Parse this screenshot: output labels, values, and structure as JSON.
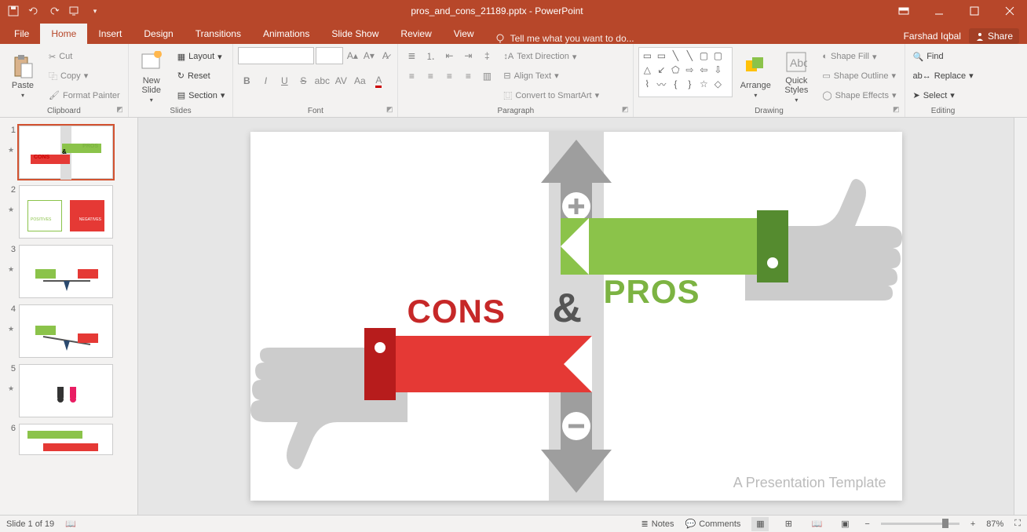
{
  "title": "pros_and_cons_21189.pptx - PowerPoint",
  "user": "Farshad Iqbal",
  "share": "Share",
  "tabs": {
    "file": "File",
    "home": "Home",
    "insert": "Insert",
    "design": "Design",
    "transitions": "Transitions",
    "animations": "Animations",
    "slideshow": "Slide Show",
    "review": "Review",
    "view": "View",
    "tellme": "Tell me what you want to do..."
  },
  "clipboard": {
    "label": "Clipboard",
    "paste": "Paste",
    "cut": "Cut",
    "copy": "Copy",
    "painter": "Format Painter"
  },
  "slides": {
    "label": "Slides",
    "new": "New\nSlide",
    "layout": "Layout",
    "reset": "Reset",
    "section": "Section"
  },
  "font": {
    "label": "Font"
  },
  "paragraph": {
    "label": "Paragraph",
    "textdir": "Text Direction",
    "align": "Align Text",
    "smartart": "Convert to SmartArt"
  },
  "drawing": {
    "label": "Drawing",
    "arrange": "Arrange",
    "quick": "Quick\nStyles",
    "fill": "Shape Fill",
    "outline": "Shape Outline",
    "effects": "Shape Effects"
  },
  "editing": {
    "label": "Editing",
    "find": "Find",
    "replace": "Replace",
    "select": "Select"
  },
  "slide_content": {
    "cons": "CONS",
    "amp": "&",
    "pros": "PROS",
    "footer": "A Presentation Template"
  },
  "status": {
    "counter": "Slide 1 of 19",
    "notes": "Notes",
    "comments": "Comments",
    "zoom": "87%"
  },
  "thumb_count": 6
}
